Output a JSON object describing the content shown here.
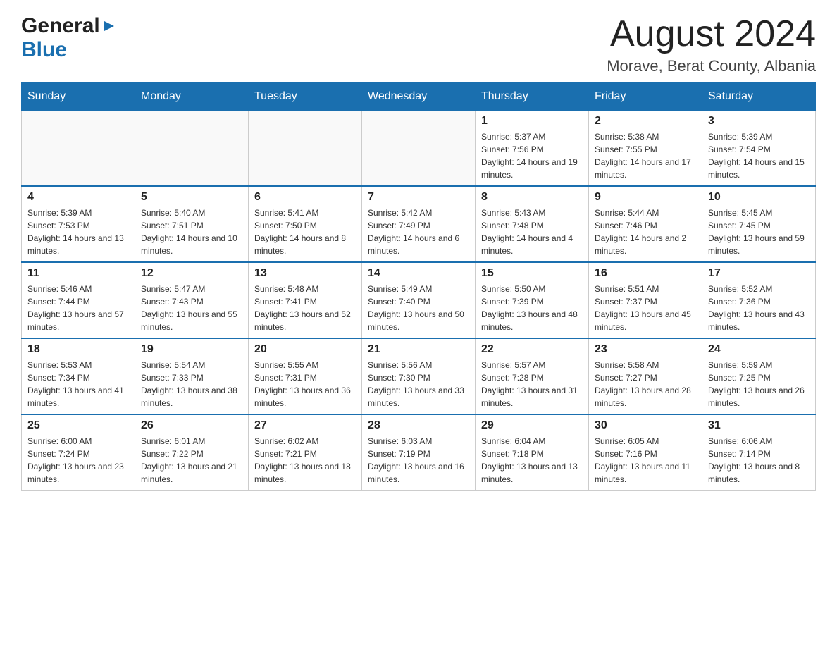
{
  "header": {
    "title": "August 2024",
    "subtitle": "Morave, Berat County, Albania",
    "logo_general": "General",
    "logo_blue": "Blue"
  },
  "calendar": {
    "days_of_week": [
      "Sunday",
      "Monday",
      "Tuesday",
      "Wednesday",
      "Thursday",
      "Friday",
      "Saturday"
    ],
    "weeks": [
      [
        {
          "day": "",
          "info": ""
        },
        {
          "day": "",
          "info": ""
        },
        {
          "day": "",
          "info": ""
        },
        {
          "day": "",
          "info": ""
        },
        {
          "day": "1",
          "info": "Sunrise: 5:37 AM\nSunset: 7:56 PM\nDaylight: 14 hours and 19 minutes."
        },
        {
          "day": "2",
          "info": "Sunrise: 5:38 AM\nSunset: 7:55 PM\nDaylight: 14 hours and 17 minutes."
        },
        {
          "day": "3",
          "info": "Sunrise: 5:39 AM\nSunset: 7:54 PM\nDaylight: 14 hours and 15 minutes."
        }
      ],
      [
        {
          "day": "4",
          "info": "Sunrise: 5:39 AM\nSunset: 7:53 PM\nDaylight: 14 hours and 13 minutes."
        },
        {
          "day": "5",
          "info": "Sunrise: 5:40 AM\nSunset: 7:51 PM\nDaylight: 14 hours and 10 minutes."
        },
        {
          "day": "6",
          "info": "Sunrise: 5:41 AM\nSunset: 7:50 PM\nDaylight: 14 hours and 8 minutes."
        },
        {
          "day": "7",
          "info": "Sunrise: 5:42 AM\nSunset: 7:49 PM\nDaylight: 14 hours and 6 minutes."
        },
        {
          "day": "8",
          "info": "Sunrise: 5:43 AM\nSunset: 7:48 PM\nDaylight: 14 hours and 4 minutes."
        },
        {
          "day": "9",
          "info": "Sunrise: 5:44 AM\nSunset: 7:46 PM\nDaylight: 14 hours and 2 minutes."
        },
        {
          "day": "10",
          "info": "Sunrise: 5:45 AM\nSunset: 7:45 PM\nDaylight: 13 hours and 59 minutes."
        }
      ],
      [
        {
          "day": "11",
          "info": "Sunrise: 5:46 AM\nSunset: 7:44 PM\nDaylight: 13 hours and 57 minutes."
        },
        {
          "day": "12",
          "info": "Sunrise: 5:47 AM\nSunset: 7:43 PM\nDaylight: 13 hours and 55 minutes."
        },
        {
          "day": "13",
          "info": "Sunrise: 5:48 AM\nSunset: 7:41 PM\nDaylight: 13 hours and 52 minutes."
        },
        {
          "day": "14",
          "info": "Sunrise: 5:49 AM\nSunset: 7:40 PM\nDaylight: 13 hours and 50 minutes."
        },
        {
          "day": "15",
          "info": "Sunrise: 5:50 AM\nSunset: 7:39 PM\nDaylight: 13 hours and 48 minutes."
        },
        {
          "day": "16",
          "info": "Sunrise: 5:51 AM\nSunset: 7:37 PM\nDaylight: 13 hours and 45 minutes."
        },
        {
          "day": "17",
          "info": "Sunrise: 5:52 AM\nSunset: 7:36 PM\nDaylight: 13 hours and 43 minutes."
        }
      ],
      [
        {
          "day": "18",
          "info": "Sunrise: 5:53 AM\nSunset: 7:34 PM\nDaylight: 13 hours and 41 minutes."
        },
        {
          "day": "19",
          "info": "Sunrise: 5:54 AM\nSunset: 7:33 PM\nDaylight: 13 hours and 38 minutes."
        },
        {
          "day": "20",
          "info": "Sunrise: 5:55 AM\nSunset: 7:31 PM\nDaylight: 13 hours and 36 minutes."
        },
        {
          "day": "21",
          "info": "Sunrise: 5:56 AM\nSunset: 7:30 PM\nDaylight: 13 hours and 33 minutes."
        },
        {
          "day": "22",
          "info": "Sunrise: 5:57 AM\nSunset: 7:28 PM\nDaylight: 13 hours and 31 minutes."
        },
        {
          "day": "23",
          "info": "Sunrise: 5:58 AM\nSunset: 7:27 PM\nDaylight: 13 hours and 28 minutes."
        },
        {
          "day": "24",
          "info": "Sunrise: 5:59 AM\nSunset: 7:25 PM\nDaylight: 13 hours and 26 minutes."
        }
      ],
      [
        {
          "day": "25",
          "info": "Sunrise: 6:00 AM\nSunset: 7:24 PM\nDaylight: 13 hours and 23 minutes."
        },
        {
          "day": "26",
          "info": "Sunrise: 6:01 AM\nSunset: 7:22 PM\nDaylight: 13 hours and 21 minutes."
        },
        {
          "day": "27",
          "info": "Sunrise: 6:02 AM\nSunset: 7:21 PM\nDaylight: 13 hours and 18 minutes."
        },
        {
          "day": "28",
          "info": "Sunrise: 6:03 AM\nSunset: 7:19 PM\nDaylight: 13 hours and 16 minutes."
        },
        {
          "day": "29",
          "info": "Sunrise: 6:04 AM\nSunset: 7:18 PM\nDaylight: 13 hours and 13 minutes."
        },
        {
          "day": "30",
          "info": "Sunrise: 6:05 AM\nSunset: 7:16 PM\nDaylight: 13 hours and 11 minutes."
        },
        {
          "day": "31",
          "info": "Sunrise: 6:06 AM\nSunset: 7:14 PM\nDaylight: 13 hours and 8 minutes."
        }
      ]
    ]
  }
}
